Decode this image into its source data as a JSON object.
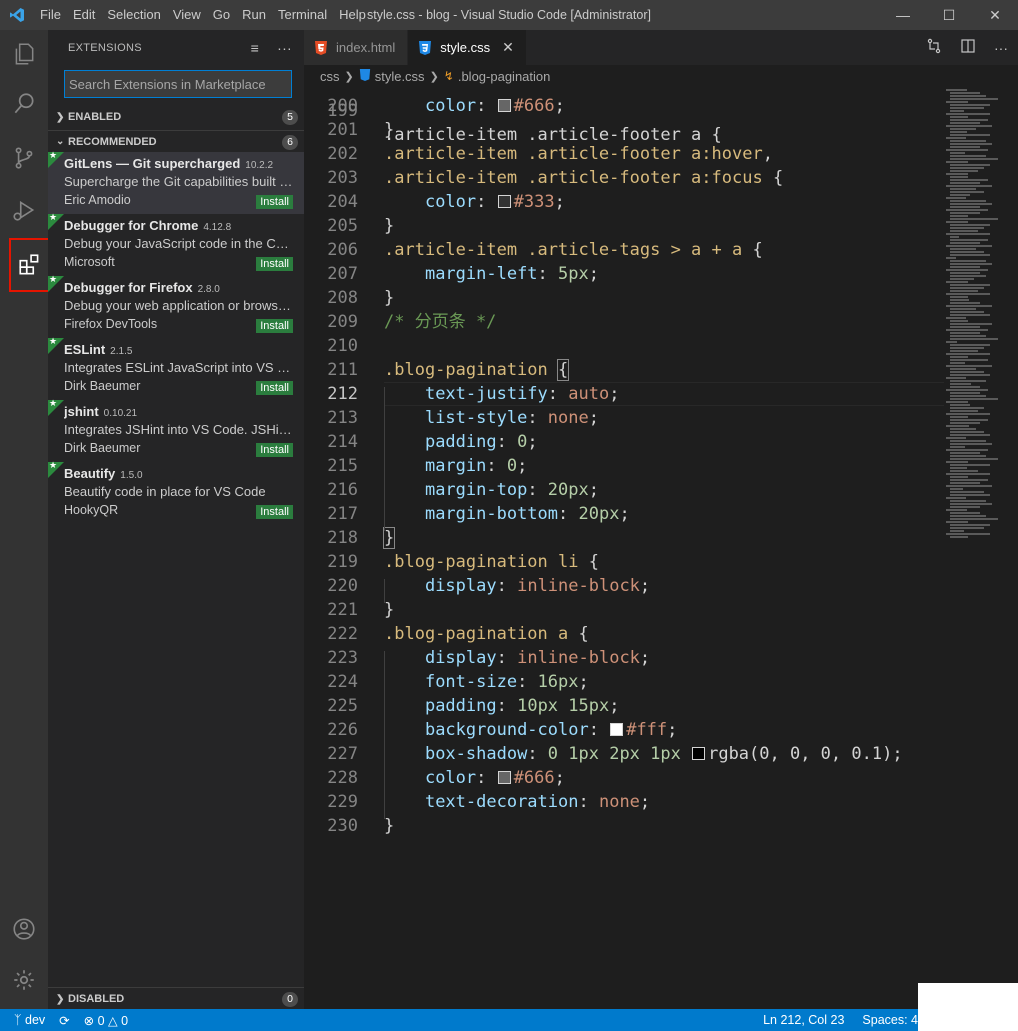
{
  "titlebar": {
    "menu": [
      "File",
      "Edit",
      "Selection",
      "View",
      "Go",
      "Run",
      "Terminal",
      "Help"
    ],
    "title": "style.css - blog - Visual Studio Code [Administrator]"
  },
  "sidebar": {
    "header": "EXTENSIONS",
    "search_placeholder": "Search Extensions in Marketplace",
    "enabled": {
      "label": "ENABLED",
      "count": "5"
    },
    "recommended": {
      "label": "RECOMMENDED",
      "count": "6"
    },
    "disabled": {
      "label": "DISABLED",
      "count": "0"
    },
    "extensions": [
      {
        "name": "GitLens — Git supercharged",
        "version": "10.2.2",
        "description": "Supercharge the Git capabilities built into VS Code",
        "publisher": "Eric Amodio",
        "action": "Install"
      },
      {
        "name": "Debugger for Chrome",
        "version": "4.12.8",
        "description": "Debug your JavaScript code in the Chrome browser",
        "publisher": "Microsoft",
        "action": "Install"
      },
      {
        "name": "Debugger for Firefox",
        "version": "2.8.0",
        "description": "Debug your web application or browser extension",
        "publisher": "Firefox DevTools",
        "action": "Install"
      },
      {
        "name": "ESLint",
        "version": "2.1.5",
        "description": "Integrates ESLint JavaScript into VS Code.",
        "publisher": "Dirk Baeumer",
        "action": "Install"
      },
      {
        "name": "jshint",
        "version": "0.10.21",
        "description": "Integrates JSHint into VS Code. JSHint is a linter",
        "publisher": "Dirk Baeumer",
        "action": "Install"
      },
      {
        "name": "Beautify",
        "version": "1.5.0",
        "description": "Beautify code in place for VS Code",
        "publisher": "HookyQR",
        "action": "Install"
      }
    ]
  },
  "tabs": [
    {
      "label": "index.html",
      "icon": "html5-icon",
      "active": false
    },
    {
      "label": "style.css",
      "icon": "css3-icon",
      "active": true
    }
  ],
  "breadcrumb": [
    "css",
    "style.css",
    ".blog-pagination"
  ],
  "editor": {
    "lines": [
      {
        "n": "200",
        "t": [
          [
            "    ",
            "punc"
          ],
          [
            "color",
            "prop"
          ],
          [
            ": ",
            "punc"
          ],
          [
            "#666",
            "val",
            "#666666"
          ],
          [
            ";",
            "punc"
          ]
        ]
      },
      {
        "n": "201",
        "t": [
          [
            "}",
            "punc"
          ]
        ]
      },
      {
        "n": "202",
        "t": [
          [
            ".article-item .article-footer a:hover",
            "sel"
          ],
          [
            ",",
            "punc"
          ]
        ]
      },
      {
        "n": "203",
        "t": [
          [
            ".article-item .article-footer a:focus",
            "sel"
          ],
          [
            " {",
            "punc"
          ]
        ]
      },
      {
        "n": "204",
        "t": [
          [
            "    ",
            "punc"
          ],
          [
            "color",
            "prop"
          ],
          [
            ": ",
            "punc"
          ],
          [
            "#333",
            "val",
            "#333333"
          ],
          [
            ";",
            "punc"
          ]
        ]
      },
      {
        "n": "205",
        "t": [
          [
            "}",
            "punc"
          ]
        ]
      },
      {
        "n": "206",
        "t": [
          [
            ".article-item .article-tags > a + a",
            "sel"
          ],
          [
            " {",
            "punc"
          ]
        ]
      },
      {
        "n": "207",
        "t": [
          [
            "    ",
            "punc"
          ],
          [
            "margin-left",
            "prop"
          ],
          [
            ": ",
            "punc"
          ],
          [
            "5px",
            "num"
          ],
          [
            ";",
            "punc"
          ]
        ]
      },
      {
        "n": "208",
        "t": [
          [
            "}",
            "punc"
          ]
        ]
      },
      {
        "n": "209",
        "t": [
          [
            "/* 分页条 */",
            "cmt"
          ]
        ]
      },
      {
        "n": "210",
        "t": []
      },
      {
        "n": "211",
        "t": [
          [
            ".blog-pagination",
            "sel"
          ],
          [
            " ",
            "punc"
          ],
          [
            "{",
            "punc brace-box"
          ]
        ]
      },
      {
        "n": "212",
        "t": [
          [
            "    ",
            "punc"
          ],
          [
            "text-justify",
            "prop"
          ],
          [
            ": ",
            "punc"
          ],
          [
            "auto",
            "val"
          ],
          [
            ";",
            "punc"
          ]
        ]
      },
      {
        "n": "213",
        "t": [
          [
            "    ",
            "punc"
          ],
          [
            "list-style",
            "prop"
          ],
          [
            ": ",
            "punc"
          ],
          [
            "none",
            "val"
          ],
          [
            ";",
            "punc"
          ]
        ]
      },
      {
        "n": "214",
        "t": [
          [
            "    ",
            "punc"
          ],
          [
            "padding",
            "prop"
          ],
          [
            ": ",
            "punc"
          ],
          [
            "0",
            "num"
          ],
          [
            ";",
            "punc"
          ]
        ]
      },
      {
        "n": "215",
        "t": [
          [
            "    ",
            "punc"
          ],
          [
            "margin",
            "prop"
          ],
          [
            ": ",
            "punc"
          ],
          [
            "0",
            "num"
          ],
          [
            ";",
            "punc"
          ]
        ]
      },
      {
        "n": "216",
        "t": [
          [
            "    ",
            "punc"
          ],
          [
            "margin-top",
            "prop"
          ],
          [
            ": ",
            "punc"
          ],
          [
            "20px",
            "num"
          ],
          [
            ";",
            "punc"
          ]
        ]
      },
      {
        "n": "217",
        "t": [
          [
            "    ",
            "punc"
          ],
          [
            "margin-bottom",
            "prop"
          ],
          [
            ": ",
            "punc"
          ],
          [
            "20px",
            "num"
          ],
          [
            ";",
            "punc"
          ]
        ]
      },
      {
        "n": "218",
        "t": [
          [
            "}",
            "punc brace-box"
          ]
        ]
      },
      {
        "n": "219",
        "t": [
          [
            ".blog-pagination li",
            "sel"
          ],
          [
            " {",
            "punc"
          ]
        ]
      },
      {
        "n": "220",
        "t": [
          [
            "    ",
            "punc"
          ],
          [
            "display",
            "prop"
          ],
          [
            ": ",
            "punc"
          ],
          [
            "inline-block",
            "val"
          ],
          [
            ";",
            "punc"
          ]
        ]
      },
      {
        "n": "221",
        "t": [
          [
            "}",
            "punc"
          ]
        ]
      },
      {
        "n": "222",
        "t": [
          [
            ".blog-pagination a",
            "sel"
          ],
          [
            " {",
            "punc"
          ]
        ]
      },
      {
        "n": "223",
        "t": [
          [
            "    ",
            "punc"
          ],
          [
            "display",
            "prop"
          ],
          [
            ": ",
            "punc"
          ],
          [
            "inline-block",
            "val"
          ],
          [
            ";",
            "punc"
          ]
        ]
      },
      {
        "n": "224",
        "t": [
          [
            "    ",
            "punc"
          ],
          [
            "font-size",
            "prop"
          ],
          [
            ": ",
            "punc"
          ],
          [
            "16px",
            "num"
          ],
          [
            ";",
            "punc"
          ]
        ]
      },
      {
        "n": "225",
        "t": [
          [
            "    ",
            "punc"
          ],
          [
            "padding",
            "prop"
          ],
          [
            ": ",
            "punc"
          ],
          [
            "10px 15px",
            "num"
          ],
          [
            ";",
            "punc"
          ]
        ]
      },
      {
        "n": "226",
        "t": [
          [
            "    ",
            "punc"
          ],
          [
            "background-color",
            "prop"
          ],
          [
            ": ",
            "punc"
          ],
          [
            "#fff",
            "val",
            "#ffffff"
          ],
          [
            ";",
            "punc"
          ]
        ]
      },
      {
        "n": "227",
        "t": [
          [
            "    ",
            "punc"
          ],
          [
            "box-shadow",
            "prop"
          ],
          [
            ": ",
            "punc"
          ],
          [
            "0 1px 2px 1px ",
            "num"
          ],
          [
            "rgba(0, 0, 0, 0.1)",
            "punc",
            "#000000"
          ],
          [
            ";",
            "punc"
          ]
        ]
      },
      {
        "n": "228",
        "t": [
          [
            "    ",
            "punc"
          ],
          [
            "color",
            "prop"
          ],
          [
            ": ",
            "punc"
          ],
          [
            "#666",
            "val",
            "#666666"
          ],
          [
            ";",
            "punc"
          ]
        ]
      },
      {
        "n": "229",
        "t": [
          [
            "    ",
            "punc"
          ],
          [
            "text-decoration",
            "prop"
          ],
          [
            ": ",
            "punc"
          ],
          [
            "none",
            "val"
          ],
          [
            ";",
            "punc"
          ]
        ]
      },
      {
        "n": "230",
        "t": [
          [
            "}",
            "punc"
          ]
        ]
      }
    ],
    "current_line": "212"
  },
  "statusbar": {
    "branch": "dev",
    "errors": "0",
    "warnings": "0",
    "position": "Ln 212, Col 23",
    "spaces": "Spaces: 4"
  },
  "colors": {
    "accent": "#007acc",
    "install": "#2b7d3e",
    "active_marker": "#e51400"
  }
}
